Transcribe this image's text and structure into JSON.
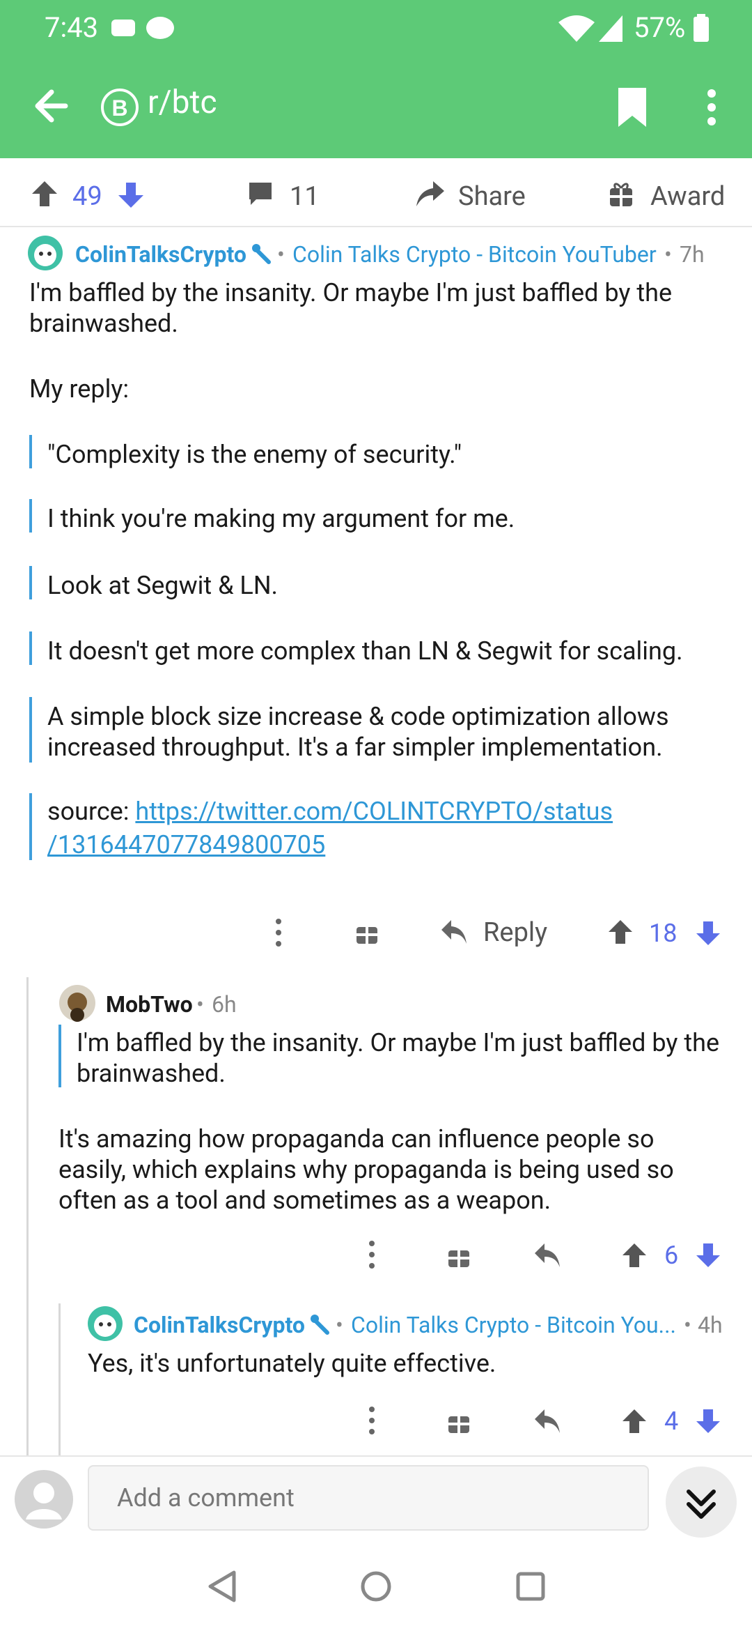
{
  "status": {
    "time": "7:43",
    "battery": "57%"
  },
  "header": {
    "subreddit": "r/btc"
  },
  "post_actions": {
    "upvotes": "49",
    "comments": "11",
    "share": "Share",
    "award": "Award"
  },
  "comments": [
    {
      "author": "ColinTalksCrypto",
      "flair": "Colin Talks Crypto - Bitcoin YouTuber",
      "age": "7h",
      "lines": [
        "I'm baffled by the insanity. Or maybe I'm just baffled by the",
        "brainwashed."
      ],
      "intro": "My reply:",
      "quotes": [
        [
          "\"Complexity is the enemy of security.\""
        ],
        [
          "I think you're making my argument for me."
        ],
        [
          "Look at Segwit & LN."
        ],
        [
          "It doesn't get more complex than LN & Segwit for scaling."
        ],
        [
          "A simple block size increase & code optimization allows",
          "increased throughput. It's a far simpler implementation."
        ]
      ],
      "source_label": "source: ",
      "source_link_1": "https://twitter.com/COLINTCRYPTO/status",
      "source_link_2": "/1316447077849800705",
      "reply": "Reply",
      "score": "18"
    },
    {
      "author": "MobTwo",
      "age": "6h",
      "quote": [
        "I'm baffled by the insanity. Or maybe I'm just baffled by the",
        "brainwashed."
      ],
      "lines": [
        "It's amazing how propaganda can influence people so",
        "easily, which explains why propaganda is being used so",
        "often as a tool and sometimes as a weapon."
      ],
      "score": "6"
    },
    {
      "author": "ColinTalksCrypto",
      "flair": "Colin Talks Crypto - Bitcoin You...",
      "age": "4h",
      "lines": [
        "Yes, it's unfortunately quite effective."
      ],
      "score": "4"
    }
  ],
  "composer": {
    "placeholder": "Add a comment"
  },
  "colors": {
    "header": "#5dca77",
    "accent": "#2e97d6",
    "vote": "#5b6ee8"
  }
}
